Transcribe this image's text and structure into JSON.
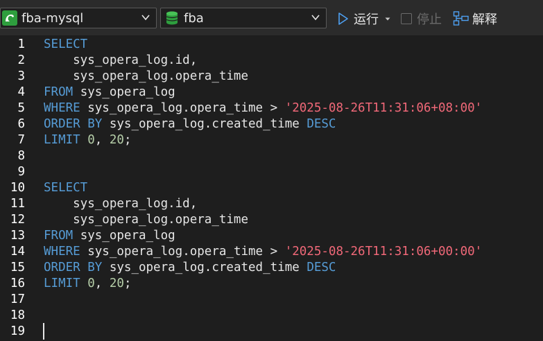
{
  "toolbar": {
    "connection": "fba-mysql",
    "database": "fba",
    "run_label": "运行",
    "stop_label": "停止",
    "explain_label": "解释"
  },
  "colors": {
    "keyword": "#569cd6",
    "string": "#f06878",
    "number": "#b5cea8",
    "text": "#e6e6e6",
    "connection_icon": "#2e9e3e",
    "database_icon": "#2e9e3e"
  },
  "editor": {
    "lines": [
      {
        "n": "1",
        "parts": [
          {
            "t": "SELECT",
            "c": "kw"
          }
        ]
      },
      {
        "n": "2",
        "parts": [
          {
            "t": "    sys_opera_log.id,",
            "c": "tx"
          }
        ]
      },
      {
        "n": "3",
        "parts": [
          {
            "t": "    sys_opera_log.opera_time",
            "c": "tx"
          }
        ]
      },
      {
        "n": "4",
        "parts": [
          {
            "t": "FROM",
            "c": "kw"
          },
          {
            "t": " sys_opera_log",
            "c": "tx"
          }
        ]
      },
      {
        "n": "5",
        "parts": [
          {
            "t": "WHERE",
            "c": "kw"
          },
          {
            "t": " sys_opera_log.opera_time > ",
            "c": "tx"
          },
          {
            "t": "'2025-08-26T11:31:06+08:00'",
            "c": "str"
          }
        ]
      },
      {
        "n": "6",
        "parts": [
          {
            "t": "ORDER BY",
            "c": "kw"
          },
          {
            "t": " sys_opera_log.created_time ",
            "c": "tx"
          },
          {
            "t": "DESC",
            "c": "kw"
          }
        ]
      },
      {
        "n": "7",
        "parts": [
          {
            "t": "LIMIT",
            "c": "kw"
          },
          {
            "t": " ",
            "c": "tx"
          },
          {
            "t": "0",
            "c": "num"
          },
          {
            "t": ", ",
            "c": "tx"
          },
          {
            "t": "20",
            "c": "num"
          },
          {
            "t": ";",
            "c": "tx"
          }
        ]
      },
      {
        "n": "8",
        "parts": []
      },
      {
        "n": "9",
        "parts": []
      },
      {
        "n": "10",
        "parts": [
          {
            "t": "SELECT",
            "c": "kw"
          }
        ]
      },
      {
        "n": "11",
        "parts": [
          {
            "t": "    sys_opera_log.id,",
            "c": "tx"
          }
        ]
      },
      {
        "n": "12",
        "parts": [
          {
            "t": "    sys_opera_log.opera_time",
            "c": "tx"
          }
        ]
      },
      {
        "n": "13",
        "parts": [
          {
            "t": "FROM",
            "c": "kw"
          },
          {
            "t": " sys_opera_log",
            "c": "tx"
          }
        ]
      },
      {
        "n": "14",
        "parts": [
          {
            "t": "WHERE",
            "c": "kw"
          },
          {
            "t": " sys_opera_log.opera_time > ",
            "c": "tx"
          },
          {
            "t": "'2025-08-26T11:31:06+00:00'",
            "c": "str"
          }
        ]
      },
      {
        "n": "15",
        "parts": [
          {
            "t": "ORDER BY",
            "c": "kw"
          },
          {
            "t": " sys_opera_log.created_time ",
            "c": "tx"
          },
          {
            "t": "DESC",
            "c": "kw"
          }
        ]
      },
      {
        "n": "16",
        "parts": [
          {
            "t": "LIMIT",
            "c": "kw"
          },
          {
            "t": " ",
            "c": "tx"
          },
          {
            "t": "0",
            "c": "num"
          },
          {
            "t": ", ",
            "c": "tx"
          },
          {
            "t": "20",
            "c": "num"
          },
          {
            "t": ";",
            "c": "tx"
          }
        ]
      },
      {
        "n": "17",
        "parts": []
      },
      {
        "n": "18",
        "parts": []
      },
      {
        "n": "19",
        "parts": []
      }
    ]
  }
}
